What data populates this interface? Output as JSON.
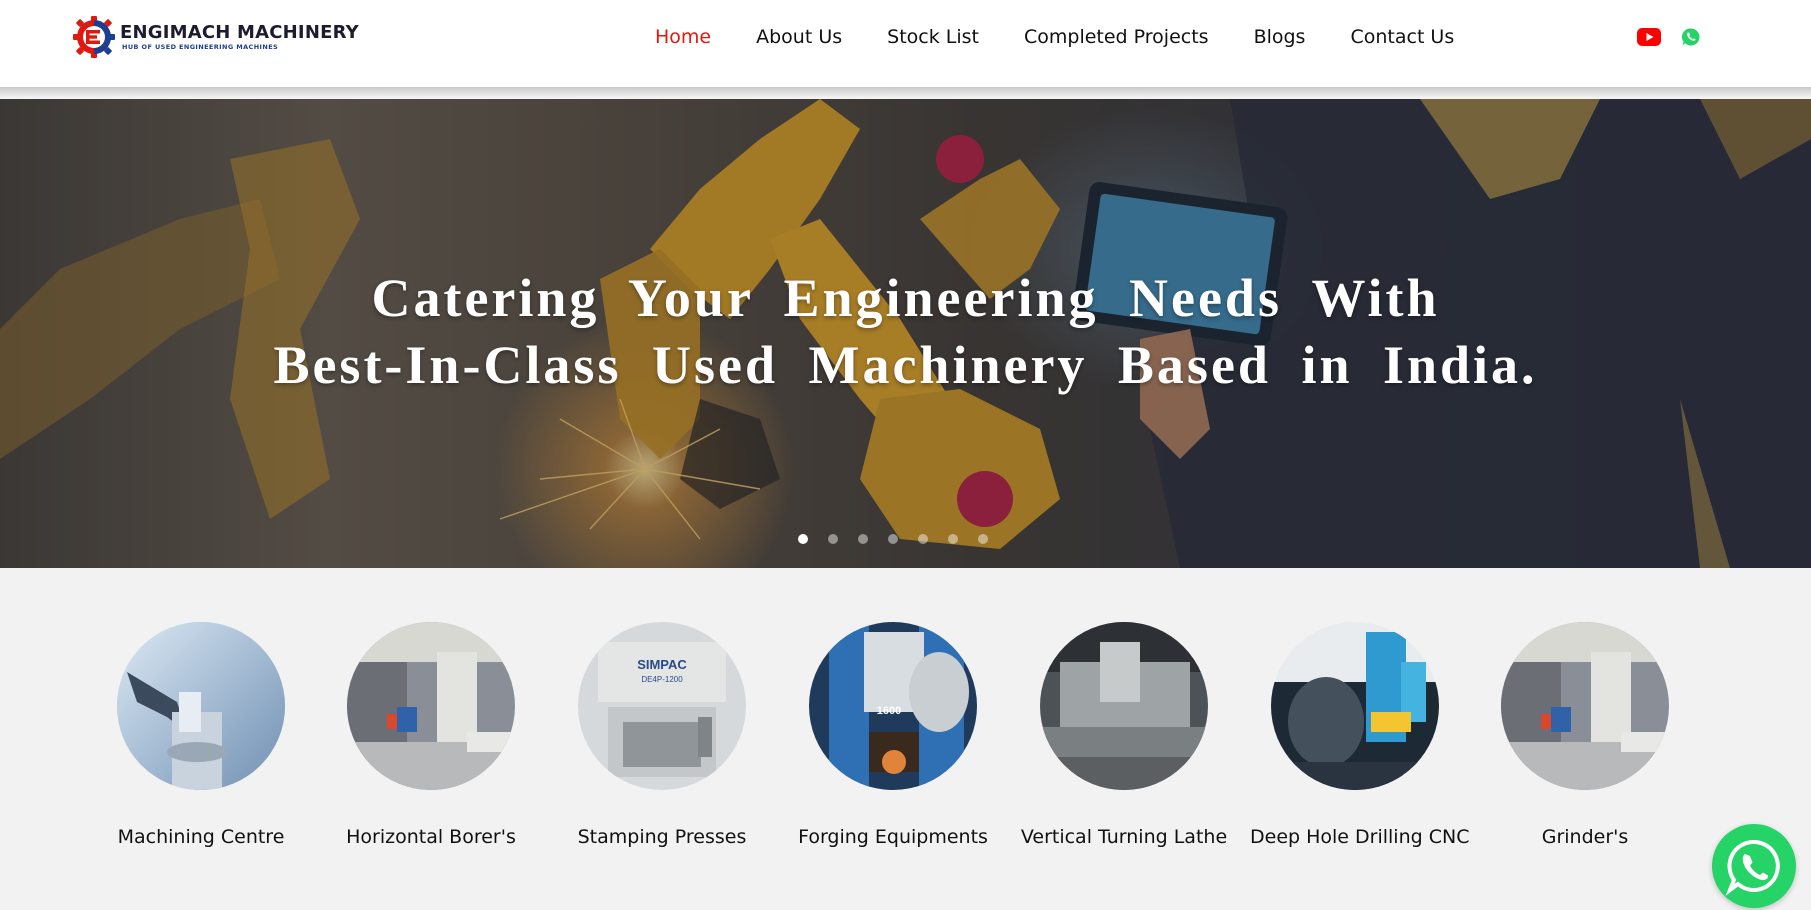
{
  "brand": {
    "name": "ENGIMACH MACHINERY",
    "tagline": "HUB OF USED ENGINEERING MACHINES",
    "logo_icon": "gear-e-logo",
    "accent": "#e0190f"
  },
  "nav": {
    "items": [
      {
        "label": "Home",
        "active": true
      },
      {
        "label": "About Us",
        "active": false
      },
      {
        "label": "Stock List",
        "active": false
      },
      {
        "label": "Completed Projects",
        "active": false
      },
      {
        "label": "Blogs",
        "active": false
      },
      {
        "label": "Contact Us",
        "active": false
      }
    ],
    "social": [
      {
        "icon": "youtube-icon",
        "color": "#ff0000"
      },
      {
        "icon": "whatsapp-icon",
        "color": "#25d366"
      }
    ]
  },
  "hero": {
    "line1": "Catering Your Engineering Needs With",
    "line2": "Best-In-Class Used Machinery Based in India.",
    "slide_count": 7,
    "active_slide": 1
  },
  "categories": [
    {
      "label": "Machining Centre"
    },
    {
      "label": "Horizontal Borer's"
    },
    {
      "label": "Stamping Presses"
    },
    {
      "label": "Forging Equipments"
    },
    {
      "label": "Vertical Turning Lathe"
    },
    {
      "label": "Deep Hole Drilling CNC"
    },
    {
      "label": "Grinder's"
    }
  ],
  "stamping_press_text": {
    "brand": "SIMPAC",
    "model": "DE4P-1200"
  },
  "forging_text": "1600",
  "floating_chat": {
    "icon": "whatsapp-icon",
    "color": "#25d366"
  }
}
